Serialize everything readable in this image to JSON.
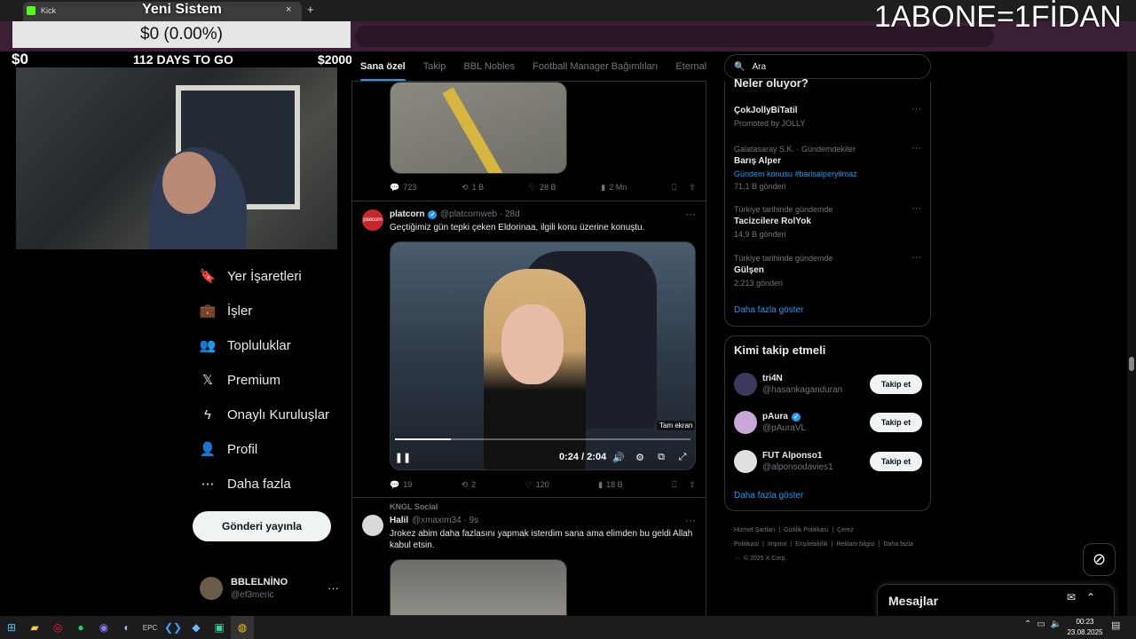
{
  "browser": {
    "tab_title": "Kick",
    "new_tab": "+",
    "close_tab": "×"
  },
  "overlay": {
    "title": "Yeni Sistem",
    "goal_text": "$0 (0.00%)",
    "goal_min": "$0",
    "goal_days": "112 DAYS TO GO",
    "goal_max": "$2000",
    "banner": "1ABONE=1FİDAN"
  },
  "nav": {
    "items": [
      {
        "label": "Yer İşaretleri",
        "icon": "bookmark-icon",
        "glyph": "🔖"
      },
      {
        "label": "İşler",
        "icon": "briefcase-icon",
        "glyph": "💼"
      },
      {
        "label": "Topluluklar",
        "icon": "people-icon",
        "glyph": "👥"
      },
      {
        "label": "Premium",
        "icon": "x-logo-icon",
        "glyph": "𝕏"
      },
      {
        "label": "Onaylı Kuruluşlar",
        "icon": "lightning-icon",
        "glyph": "ϟ"
      },
      {
        "label": "Profil",
        "icon": "person-icon",
        "glyph": "👤"
      },
      {
        "label": "Daha fazla",
        "icon": "more-circle-icon",
        "glyph": "⋯"
      }
    ],
    "post_button": "Gönderi yayınla",
    "account_name": "BBLELNİNO",
    "account_handle": "@ef3meric",
    "account_more": "···"
  },
  "tabs": [
    "Sana özel",
    "Takip",
    "BBL Nobles",
    "Football Manager Bağımlıları",
    "Eternal Fi"
  ],
  "post0": {
    "replies": "723",
    "reposts": "1 B",
    "likes": "28 B",
    "views": "2 Mn"
  },
  "post1": {
    "avatar_text": "platcorn",
    "name": "platcorn",
    "meta": "@platcornweb · 28d",
    "text": "Geçtiğimiz gün tepki çeken Eldorinaa, ilgili konu üzerine konuştu.",
    "video_time": "0:24 / 2:04",
    "video_progress": 0.19,
    "tooltip": "Tam ekran",
    "replies": "19",
    "reposts": "2",
    "likes": "120",
    "views": "18 B"
  },
  "post2": {
    "context": "KNGL Social",
    "name": "Halil",
    "meta": "@xmaxim34 · 9s",
    "text": "Jrokez abim daha fazlasını yapmak isterdim sana ama elimden bu geldi Allah kabul etsin."
  },
  "search": {
    "placeholder": "Ara"
  },
  "trends": {
    "title": "Neler oluyor?",
    "items": [
      {
        "category": "",
        "name": "ÇokJollyBiTatil",
        "count": "Promoted by JOLLY"
      },
      {
        "category": "Galatasaray S.K. · Gündemdekiler",
        "name": "Barış Alper",
        "count": "Gündem konusu #barisalperyilmaz",
        "count2": "71,1 B gönderi"
      },
      {
        "category": "Türkiye tarihinde gündemde",
        "name": "Tacizcilere RolYok",
        "count": "14,9 B gönderi"
      },
      {
        "category": "Türkiye tarihinde gündemde",
        "name": "Gülşen",
        "count": "2.213 gönderi"
      }
    ],
    "show_more": "Daha fazla göster"
  },
  "who_to_follow": {
    "title": "Kimi takip etmeli",
    "items": [
      {
        "name": "tri4N",
        "handle": "@hasankaganduran",
        "verified": false,
        "avatar_color": "#3a3a5c"
      },
      {
        "name": "pAura",
        "handle": "@pAuraVL",
        "verified": true,
        "avatar_color": "#c7a8d9"
      },
      {
        "name": "FUT Alponso1",
        "handle": "@alponsodavies1",
        "verified": false,
        "avatar_color": "#e0e0e0"
      }
    ],
    "follow_label": "Takip et",
    "show_more": "Daha fazla göster"
  },
  "footer": {
    "links": [
      "Hizmet Şartları",
      "|",
      "Gizlilik Politikası",
      "|",
      "Çerez Politikası",
      "|",
      "Imprint",
      "|",
      "Erişilebilirlik",
      "|",
      "Reklam bilgisi",
      "|",
      "Daha fazla ···",
      "© 2025 X Corp."
    ]
  },
  "messages": {
    "label": "Mesajlar"
  },
  "taskbar": {
    "time": "00:23",
    "date": "23.08.2025"
  },
  "colors": {
    "accent": "#1d9bf0",
    "background": "#000000",
    "border": "#2f3336"
  }
}
